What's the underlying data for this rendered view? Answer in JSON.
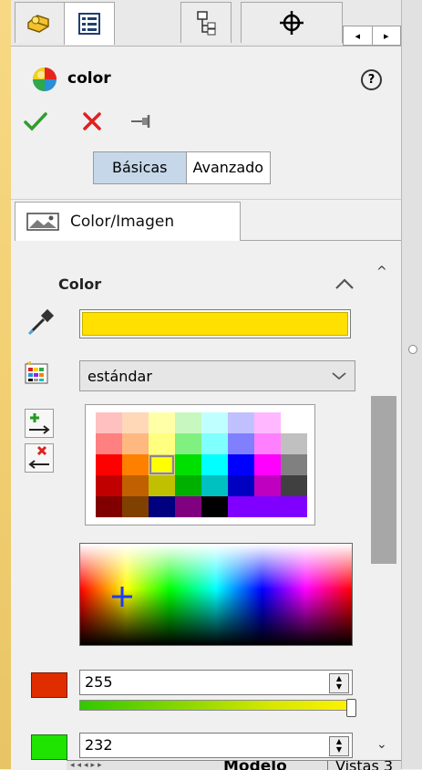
{
  "tabs": [
    {
      "icon": "feature-manager-icon"
    },
    {
      "icon": "property-manager-icon",
      "active": true
    },
    {
      "icon": "configuration-manager-icon"
    },
    {
      "icon": "dimxpert-icon"
    }
  ],
  "panel": {
    "title": "color",
    "help_label": "?",
    "mode_basic": "Básicas",
    "mode_advanced": "Avanzado",
    "subtab_label": "Color/Imagen"
  },
  "color_section": {
    "title": "Color",
    "current_color": "#ffe000",
    "palette_select": "estándar",
    "swatches": [
      "#ffc0c0",
      "#ffd8b8",
      "#ffffa8",
      "#c8f8c0",
      "#c0ffff",
      "#c0c0ff",
      "#ffb8ff",
      "#ffffff",
      "#ff8080",
      "#ffb880",
      "#ffff80",
      "#80f080",
      "#80ffff",
      "#8080ff",
      "#ff80ff",
      "#c0c0c0",
      "#ff0000",
      "#ff8000",
      "#ffff00",
      "#00e000",
      "#00ffff",
      "#0000ff",
      "#ff00ff",
      "#808080",
      "#c00000",
      "#c06000",
      "#c0c000",
      "#00b000",
      "#00c0c0",
      "#0000c0",
      "#c000c0",
      "#404040",
      "#800000",
      "#804000",
      "#000080",
      "#800080",
      "#000000",
      "#8000ff",
      "#8000ff",
      "#8000ff"
    ],
    "selected_swatch": 18,
    "red_value": "255",
    "green_value": "232"
  },
  "bottom": {
    "tab_model": "Modelo",
    "tab_views": "Vistas 3"
  },
  "colors": {
    "accent_check": "#2e9e2e",
    "accent_cross": "#e02020",
    "segment_active": "#c6d7ea"
  }
}
